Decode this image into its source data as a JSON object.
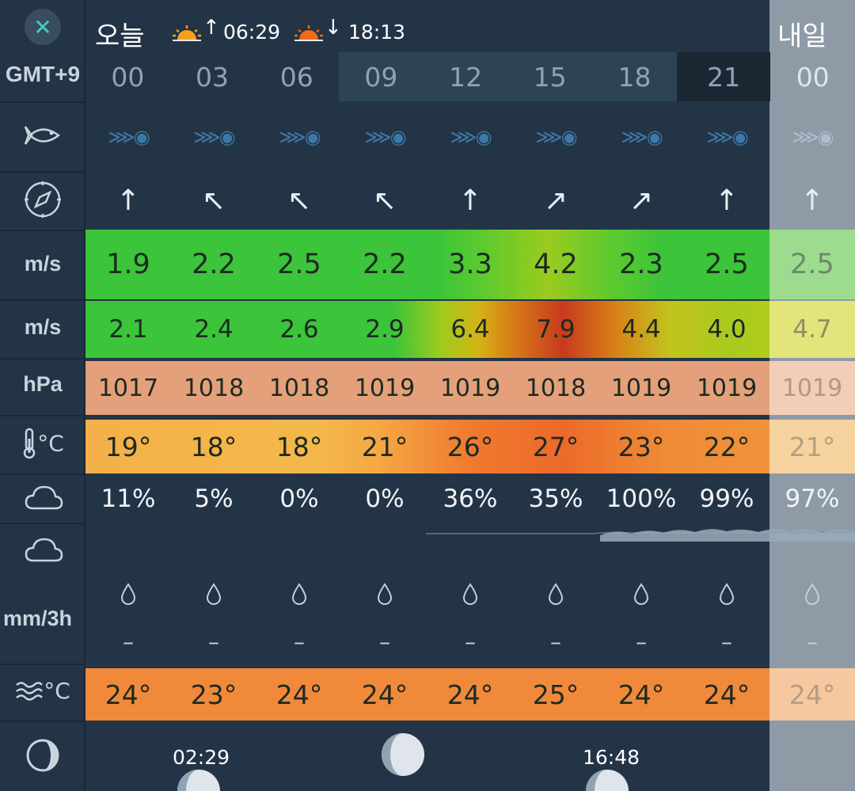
{
  "header": {
    "close_glyph": "✕",
    "today_label": "오늘",
    "sunrise_arrow": "↑",
    "sunrise_time": "06:29",
    "sunset_arrow": "↓",
    "sunset_time": "18:13",
    "tomorrow_label": "내일"
  },
  "row_labels": {
    "timezone": "GMT+9",
    "fish_icon": "fish-icon",
    "direction_icon": "compass-icon",
    "wind_unit": "m/s",
    "gust_unit": "m/s",
    "pressure_unit": "hPa",
    "temp_unit": "°C",
    "cloud_icon": "cloud-icon",
    "precip_unit": "mm/3h",
    "water_temp_unit": "°C",
    "moon_icon": "moon-phase-icon"
  },
  "hours": [
    "00",
    "03",
    "06",
    "09",
    "12",
    "15",
    "18",
    "21",
    "00"
  ],
  "fish_glyph": "⋙◉",
  "wind_arrows": [
    "↑",
    "↖",
    "↖",
    "↖",
    "↑",
    "↗",
    "↗",
    "↑",
    "↑"
  ],
  "wind_speed": [
    "1.9",
    "2.2",
    "2.5",
    "2.2",
    "3.3",
    "4.2",
    "2.3",
    "2.5",
    "2.5"
  ],
  "wind_gust": [
    "2.1",
    "2.4",
    "2.6",
    "2.9",
    "6.4",
    "7.9",
    "4.4",
    "4.0",
    "4.7"
  ],
  "pressure": [
    "1017",
    "1018",
    "1018",
    "1019",
    "1019",
    "1018",
    "1019",
    "1019",
    "1019"
  ],
  "temperature": [
    "19°",
    "18°",
    "18°",
    "21°",
    "26°",
    "27°",
    "23°",
    "22°",
    "21°"
  ],
  "cloud_cover": [
    "11%",
    "5%",
    "0%",
    "0%",
    "36%",
    "35%",
    "100%",
    "99%",
    "97%"
  ],
  "precip_drop": [
    "💧"
  ],
  "precip": [
    "–",
    "–",
    "–",
    "–",
    "–",
    "–",
    "–",
    "–",
    "–"
  ],
  "water_temp": [
    "24°",
    "23°",
    "24°",
    "24°",
    "24°",
    "25°",
    "24°",
    "24°",
    "24°"
  ],
  "moon": {
    "moonset_time": "02:29",
    "moonrise_time": "16:48"
  },
  "colors": {
    "background": "#243447",
    "accent": "#3fd0c0",
    "wind_green": "#3cc43a",
    "gust_red": "#c83a1e",
    "pressure": "#e49a6e",
    "temp_orange": "#f07a30",
    "water_orange": "#f28a3a",
    "tomorrow_overlay": "#8e9aa6"
  }
}
